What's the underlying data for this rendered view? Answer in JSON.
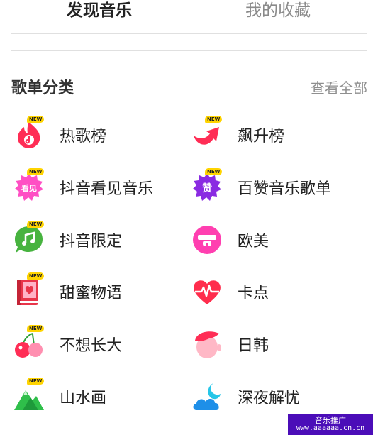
{
  "tabs": {
    "active": "发现音乐",
    "inactive": "我的收藏"
  },
  "section": {
    "title": "歌单分类",
    "view_all": "查看全部"
  },
  "badge_text": "NEW",
  "categories": [
    {
      "label": "热歌榜",
      "icon": "flame-icon",
      "color": "#ff2d55"
    },
    {
      "label": "飙升榜",
      "icon": "rising-arrow-icon",
      "color": "#ff2d55"
    },
    {
      "label": "抖音看见音乐",
      "icon": "starburst-kanjian-icon",
      "color": "#ff4fc4",
      "icon_text": "看见"
    },
    {
      "label": "百赞音乐歌单",
      "icon": "starburst-zan-icon",
      "color": "#8a2be2",
      "icon_text": "赞"
    },
    {
      "label": "抖音限定",
      "icon": "music-note-bubble-icon",
      "color": "#47b33f"
    },
    {
      "label": "欧美",
      "icon": "sunglasses-face-icon",
      "color": "#ff3fb0"
    },
    {
      "label": "甜蜜物语",
      "icon": "heart-book-icon",
      "color": "#e8354a"
    },
    {
      "label": "卡点",
      "icon": "heartbeat-icon",
      "color": "#ff2d4d"
    },
    {
      "label": "不想长大",
      "icon": "cherry-icon",
      "color": "#ff2d55"
    },
    {
      "label": "日韩",
      "icon": "face-hair-icon",
      "color": "#ff2d55"
    },
    {
      "label": "山水画",
      "icon": "mountain-icon",
      "color": "#2fbf4a"
    },
    {
      "label": "深夜解忧",
      "icon": "moon-cloud-icon",
      "color": "#1e8fe8"
    }
  ],
  "watermark": {
    "line1": "音乐推广",
    "line2": "www.aaaaaa.cn.cn"
  }
}
